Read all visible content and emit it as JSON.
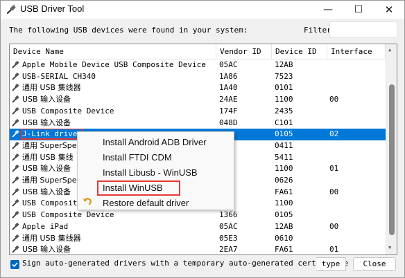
{
  "window": {
    "title": "USB Driver Tool",
    "controls": {
      "minimize": "—",
      "maximize": "☐",
      "close": "✕"
    }
  },
  "header": {
    "found_text": "The following USB devices were found in your system:",
    "filter_label": "Filter",
    "filter_value": ""
  },
  "table": {
    "columns": [
      "Device Name",
      "Vendor ID",
      "Device ID",
      "Interface"
    ],
    "rows": [
      {
        "name": "Apple Mobile Device USB Composite Device",
        "vendor": "05AC",
        "device": "12AB",
        "interface": ""
      },
      {
        "name": "USB-SERIAL CH340",
        "vendor": "1A86",
        "device": "7523",
        "interface": ""
      },
      {
        "name": "通用 USB 集线器",
        "vendor": "1A40",
        "device": "0101",
        "interface": ""
      },
      {
        "name": "USB 输入设备",
        "vendor": "24AE",
        "device": "1100",
        "interface": "00"
      },
      {
        "name": "USB Composite Device",
        "vendor": "174F",
        "device": "2435",
        "interface": ""
      },
      {
        "name": "USB 输入设备",
        "vendor": "048D",
        "device": "C101",
        "interface": ""
      },
      {
        "name": "J-Link driver",
        "vendor": "",
        "device": "0105",
        "interface": "02"
      },
      {
        "name": "通用 SuperSpe",
        "vendor": "",
        "device": "0411",
        "interface": ""
      },
      {
        "name": "通用 USB 集线",
        "vendor": "",
        "device": "5411",
        "interface": ""
      },
      {
        "name": "USB 输入设备",
        "vendor": "",
        "device": "1100",
        "interface": "01"
      },
      {
        "name": "通用 SuperSpe",
        "vendor": "",
        "device": "0626",
        "interface": ""
      },
      {
        "name": "USB 输入设备",
        "vendor": "",
        "device": "FA61",
        "interface": "00"
      },
      {
        "name": "USB Composite",
        "vendor": "",
        "device": "1100",
        "interface": ""
      },
      {
        "name": "USB Composite Device",
        "vendor": "1366",
        "device": "0105",
        "interface": ""
      },
      {
        "name": "Apple iPad",
        "vendor": "05AC",
        "device": "12AB",
        "interface": "00"
      },
      {
        "name": "通用 USB 集线器",
        "vendor": "05E3",
        "device": "0610",
        "interface": ""
      },
      {
        "name": "USB 输入设备",
        "vendor": "2EA7",
        "device": "FA61",
        "interface": "01"
      }
    ],
    "selected_row_index": 6
  },
  "context_menu": {
    "items": [
      "Install Android ADB Driver",
      "Install FTDI CDM",
      "Install Libusb - WinUSB",
      "Install WinUSB",
      "Restore default driver"
    ]
  },
  "footer": {
    "sign_checkbox_label": "Sign auto-generated drivers with a temporary auto-generated certificate",
    "sign_checked": true,
    "type_button": "type",
    "close_button": "Close"
  },
  "colors": {
    "selection": "#0078d7",
    "highlight_box": "#e53935",
    "checkbox": "#0067c0"
  }
}
